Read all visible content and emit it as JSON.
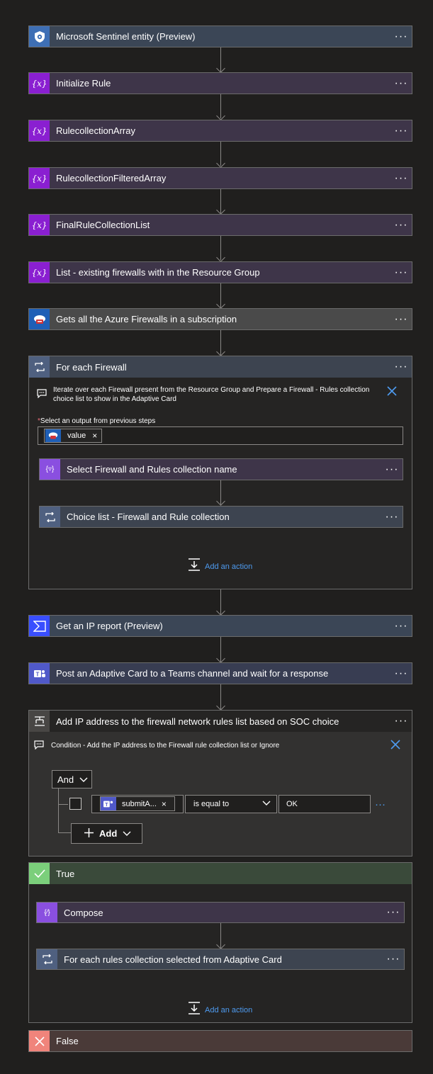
{
  "steps": {
    "sentinel": "Microsoft Sentinel entity (Preview)",
    "init_rule": "Initialize Rule",
    "rule_array": "RulecollectionArray",
    "rule_filtered": "RulecollectionFilteredArray",
    "final_rule": "FinalRuleCollectionList",
    "list_fw": "List - existing firewalls with in the Resource Group",
    "get_fw": "Gets all the Azure Firewalls in a subscription",
    "foreach_fw": "For each Firewall",
    "ip_report": "Get an IP report (Preview)",
    "post_card": "Post an Adaptive Card to a Teams channel and wait for a response",
    "add_ip": "Add IP address to the firewall network rules list based on SOC choice"
  },
  "more_label": "···",
  "var_icon": "{x}",
  "foreach": {
    "note": "Iterate over each Firewall present from the Resource Group and Prepare a Firewall - Rules collection choice list to show in the Adaptive Card",
    "required_mark": "*",
    "select_label": "Select an output from previous steps",
    "token": "value",
    "token_close": "×",
    "select_step": "Select Firewall and Rules collection name",
    "choice_step": "Choice list - Firewall and Rule collection",
    "add_action": "Add an action"
  },
  "condition": {
    "note": "Condition - Add the IP address to the Firewall rule collection list or Ignore",
    "and_label": "And",
    "token": "submitA...",
    "token_close": "×",
    "operator": "is equal to",
    "value": "OK",
    "row_more": "···",
    "add_label": "Add"
  },
  "true_branch": {
    "label": "True",
    "compose": "Compose",
    "foreach_rules": "For each rules collection selected from Adaptive Card",
    "add_action": "Add an action"
  },
  "false_branch": {
    "label": "False"
  },
  "colors": {
    "background": "#201f1e",
    "variable_accent": "#8a1fd1",
    "variable_card": "#3e3549",
    "sentinel_accent": "#4a74b8",
    "link": "#4e9bf0",
    "true_green": "#7bcf7b",
    "false_red": "#f0847b"
  }
}
